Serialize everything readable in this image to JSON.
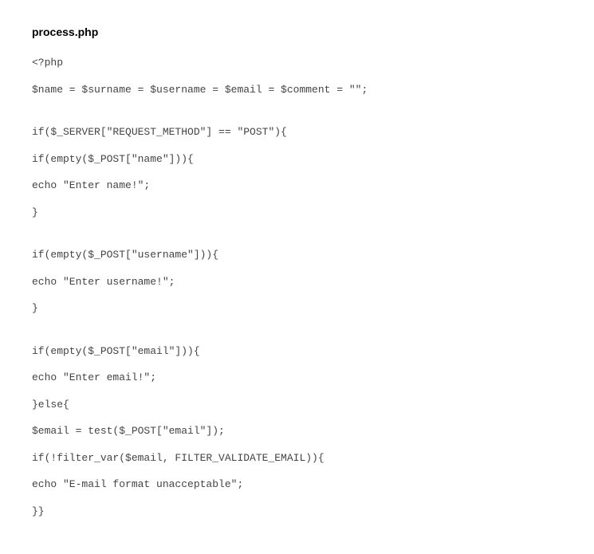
{
  "filename": "process.php",
  "code": {
    "l1": "<?php",
    "l2": "$name = $surname = $username = $email = $comment = \"\";",
    "l3": "if($_SERVER[\"REQUEST_METHOD\"] == \"POST\"){",
    "l4": "if(empty($_POST[\"name\"])){",
    "l5": "echo \"Enter name!\";",
    "l6": "}",
    "l7": "if(empty($_POST[\"username\"])){",
    "l8": "echo \"Enter username!\";",
    "l9": "}",
    "l10": "if(empty($_POST[\"email\"])){",
    "l11": "echo \"Enter email!\";",
    "l12": "}else{",
    "l13": "$email = test($_POST[\"email\"]);",
    "l14": "if(!filter_var($email, FILTER_VALIDATE_EMAIL)){",
    "l15": "echo \"E-mail format unacceptable\";",
    "l16": "}}"
  }
}
